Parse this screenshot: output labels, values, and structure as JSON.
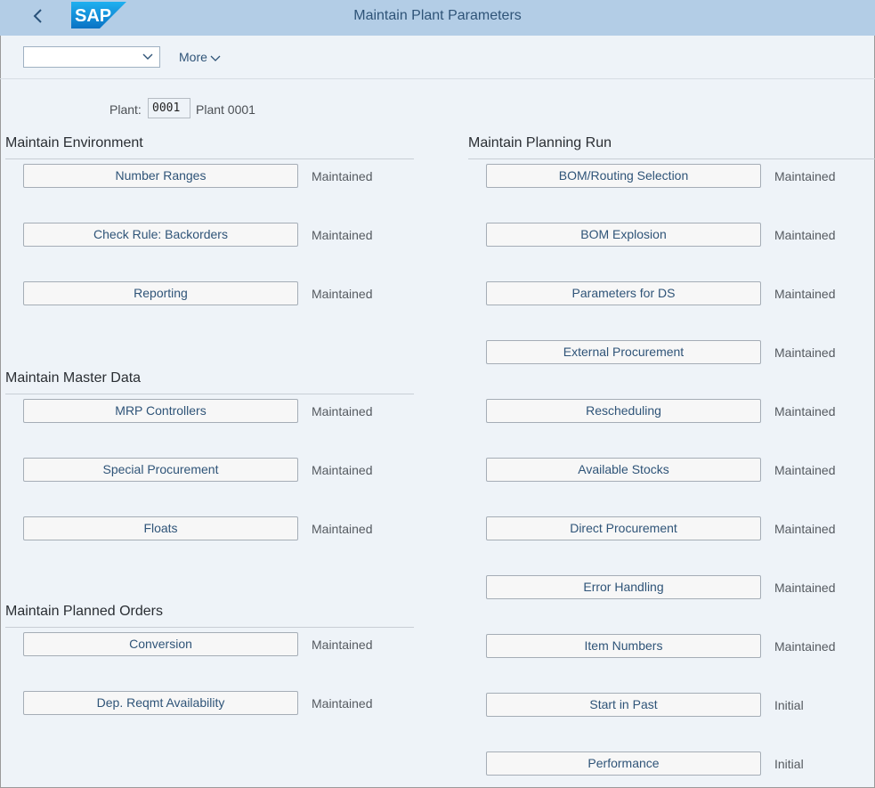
{
  "shell": {
    "title": "Maintain Plant Parameters",
    "logo_text": "SAP",
    "back_icon": "chevron-left-icon"
  },
  "toolbar": {
    "dropdown_value": "",
    "more_label": "More"
  },
  "plant": {
    "label": "Plant:",
    "value": "0001",
    "description": "Plant 0001"
  },
  "left": {
    "environment": {
      "heading": "Maintain Environment",
      "items": [
        {
          "label": "Number Ranges",
          "status": "Maintained"
        },
        {
          "label": "Check Rule: Backorders",
          "status": "Maintained"
        },
        {
          "label": "Reporting",
          "status": "Maintained"
        }
      ]
    },
    "master_data": {
      "heading": "Maintain Master Data",
      "items": [
        {
          "label": "MRP Controllers",
          "status": "Maintained"
        },
        {
          "label": "Special Procurement",
          "status": "Maintained"
        },
        {
          "label": "Floats",
          "status": "Maintained"
        }
      ]
    },
    "planned_orders": {
      "heading": "Maintain Planned Orders",
      "items": [
        {
          "label": "Conversion",
          "status": "Maintained"
        },
        {
          "label": "Dep. Reqmt Availability",
          "status": "Maintained"
        }
      ]
    }
  },
  "right": {
    "planning_run": {
      "heading": "Maintain Planning Run",
      "items": [
        {
          "label": "BOM/Routing Selection",
          "status": "Maintained"
        },
        {
          "label": "BOM Explosion",
          "status": "Maintained"
        },
        {
          "label": "Parameters for DS",
          "status": "Maintained"
        },
        {
          "label": "External Procurement",
          "status": "Maintained"
        },
        {
          "label": "Rescheduling",
          "status": "Maintained"
        },
        {
          "label": "Available Stocks",
          "status": "Maintained"
        },
        {
          "label": "Direct Procurement",
          "status": "Maintained"
        },
        {
          "label": "Error Handling",
          "status": "Maintained"
        },
        {
          "label": "Item Numbers",
          "status": "Maintained"
        },
        {
          "label": "Start in Past",
          "status": "Initial"
        },
        {
          "label": "Performance",
          "status": "Initial"
        }
      ]
    }
  },
  "colors": {
    "shell_bg": "#b3cde6",
    "page_bg": "#eef3f8",
    "link_blue": "#2f5478",
    "logo_blue": "#1a9be0"
  }
}
